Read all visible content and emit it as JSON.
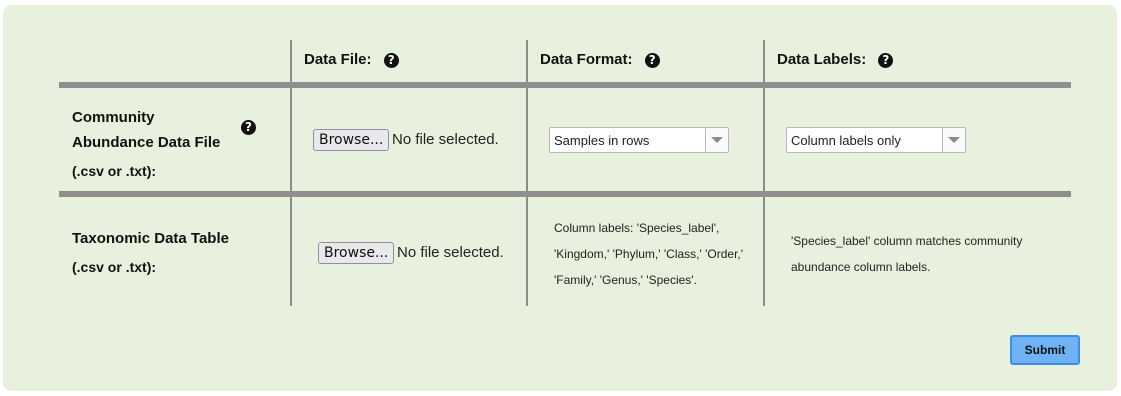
{
  "headers": {
    "data_file": "Data File:",
    "data_format": "Data Format:",
    "data_labels": "Data Labels:"
  },
  "help_icon": "?",
  "rows": {
    "community": {
      "label_line1": "Community",
      "label_line2": "Abundance Data File",
      "label_line3": "(.csv or .txt):",
      "browse_label": "Browse...",
      "file_status": "No file selected.",
      "format_selected": "Samples in rows",
      "labels_selected": "Column labels only"
    },
    "taxonomic": {
      "label_line1": "Taxonomic Data Table",
      "label_line2": "(.csv or .txt):",
      "browse_label": "Browse...",
      "file_status": "No file selected.",
      "format_note_line1": "Column labels: 'Species_label',",
      "format_note_line2": "'Kingdom,' 'Phylum,' 'Class,' 'Order,'",
      "format_note_line3": "'Family,' 'Genus,' 'Species'.",
      "labels_note_line1": "'Species_label' column matches community",
      "labels_note_line2": "abundance column labels."
    }
  },
  "submit_label": "Submit",
  "colors": {
    "panel_bg": "#e8f1dd",
    "submit_bg": "#6fb2f5",
    "rule": "#8f8f8f"
  }
}
